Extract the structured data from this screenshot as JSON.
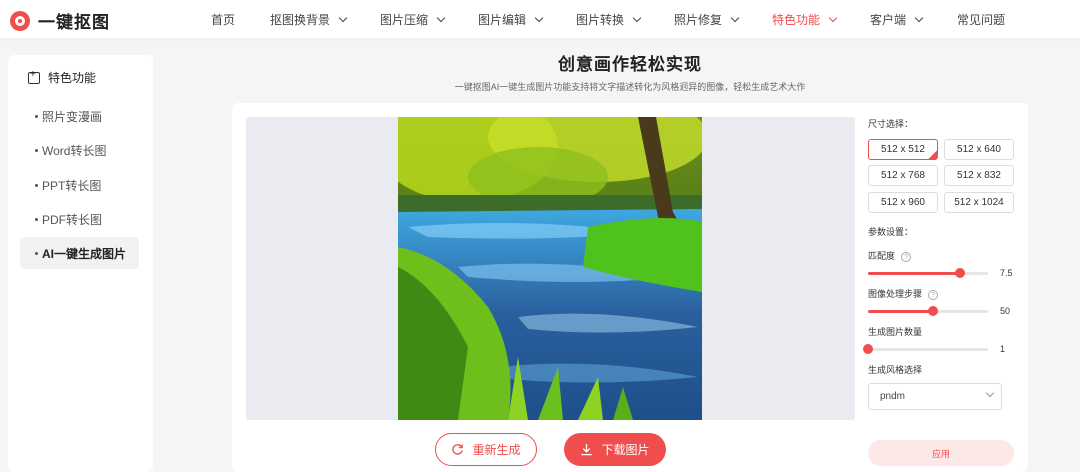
{
  "app": {
    "title": "一键抠图",
    "brand_color": "#f04e4e"
  },
  "nav": {
    "items": [
      {
        "label": "首页",
        "has_dropdown": false
      },
      {
        "label": "抠图换背景",
        "has_dropdown": true
      },
      {
        "label": "图片压缩",
        "has_dropdown": true
      },
      {
        "label": "图片编辑",
        "has_dropdown": true
      },
      {
        "label": "图片转换",
        "has_dropdown": true
      },
      {
        "label": "照片修复",
        "has_dropdown": true
      },
      {
        "label": "特色功能",
        "has_dropdown": true,
        "active": true
      },
      {
        "label": "客户端",
        "has_dropdown": true
      },
      {
        "label": "常见问题",
        "has_dropdown": false
      }
    ]
  },
  "sidebar": {
    "title": "特色功能",
    "items": [
      {
        "label": "照片变漫画"
      },
      {
        "label": "Word转长图"
      },
      {
        "label": "PPT转长图"
      },
      {
        "label": "PDF转长图"
      },
      {
        "label": "AI一键生成图片",
        "active": true
      }
    ]
  },
  "main": {
    "title": "创意画作轻松实现",
    "subtitle": "一键抠图AI一键生成图片功能支持将文字描述转化为风格迥异的图像，轻松生成艺术大作"
  },
  "actions": {
    "regenerate_label": "重新生成",
    "download_label": "下载图片"
  },
  "settings": {
    "size_label": "尺寸选择：",
    "sizes": [
      "512 x 512",
      "512 x 640",
      "512 x 768",
      "512 x 832",
      "512 x 960",
      "512 x 1024"
    ],
    "selected_size": "512 x 512",
    "params_label": "参数设置：",
    "match": {
      "label": "匹配度",
      "value": "7.5",
      "fraction": 0.77
    },
    "steps": {
      "label": "图像处理步骤",
      "value": "50",
      "fraction": 0.54
    },
    "count": {
      "label": "生成图片数量",
      "value": "1",
      "fraction": 0.0
    },
    "style_label": "生成风格选择",
    "style_value": "pndm",
    "apply_label": "应用"
  }
}
